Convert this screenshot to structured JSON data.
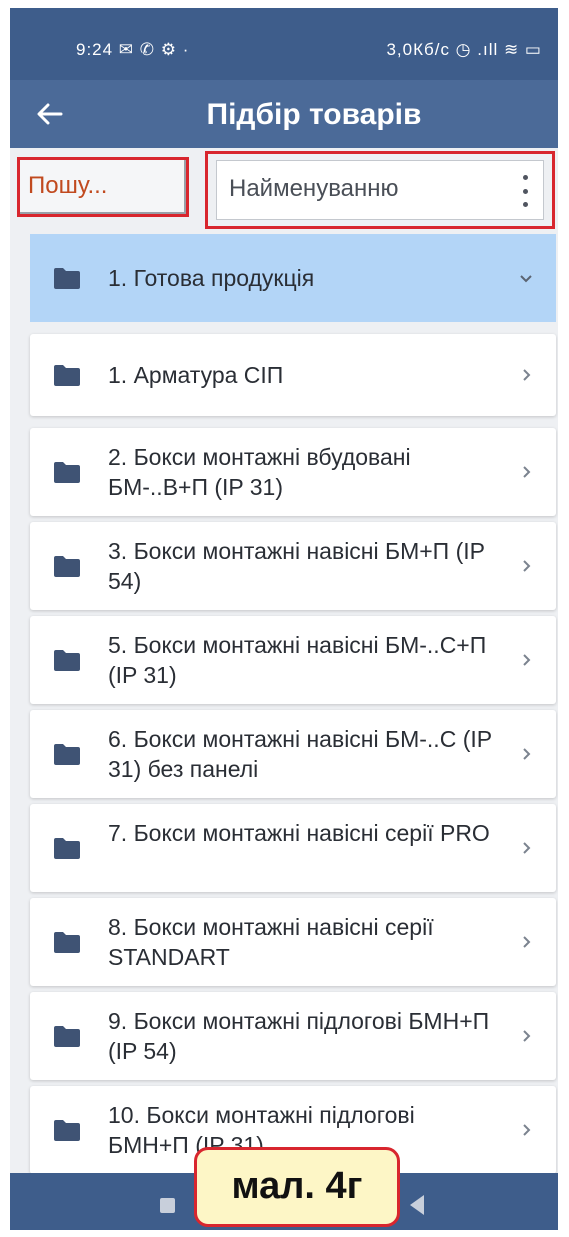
{
  "status_bar": {
    "left": "9:24 ✉ ✆ ⚙ ·",
    "right": "3,0Кб/с ◷ .ıll ≋ ▭"
  },
  "header": {
    "title": "Підбір товарів",
    "back_icon": "arrow-left-icon"
  },
  "search": {
    "placeholder": "Пошу..."
  },
  "sort": {
    "value": "Найменуванню",
    "menu_icon": "kebab-menu-icon"
  },
  "groups": [
    {
      "label": "1. Готова продукція",
      "expanded": true
    },
    {
      "label": "1. Арматура СІП"
    },
    {
      "label": "2. Бокси монтажні вбудовані БМ-..В+П (IP 31)"
    },
    {
      "label": "3. Бокси монтажні навісні БМ+П (IP 54)"
    },
    {
      "label": "5. Бокси монтажні навісні БМ-..С+П (IP 31)"
    },
    {
      "label": "6. Бокси монтажні навісні БМ-..С (IP 31) без панелі"
    },
    {
      "label": "7. Бокси монтажні навісні серії PRO"
    },
    {
      "label": "8. Бокси монтажні навісні серії STANDART"
    },
    {
      "label": "9. Бокси монтажні підлогові БМН+П (IP 54)"
    },
    {
      "label": "10. Бокси монтажні підлогові БМН+П (IP 31)"
    }
  ],
  "caption": "мал. 4г",
  "colors": {
    "app_bar": "#4b6a98",
    "status_bar": "#3e5d8b",
    "expanded_row": "#b3d5f7",
    "folder_icon": "#3f5374",
    "highlight_border": "#d8262e",
    "search_text": "#c14a1f"
  }
}
